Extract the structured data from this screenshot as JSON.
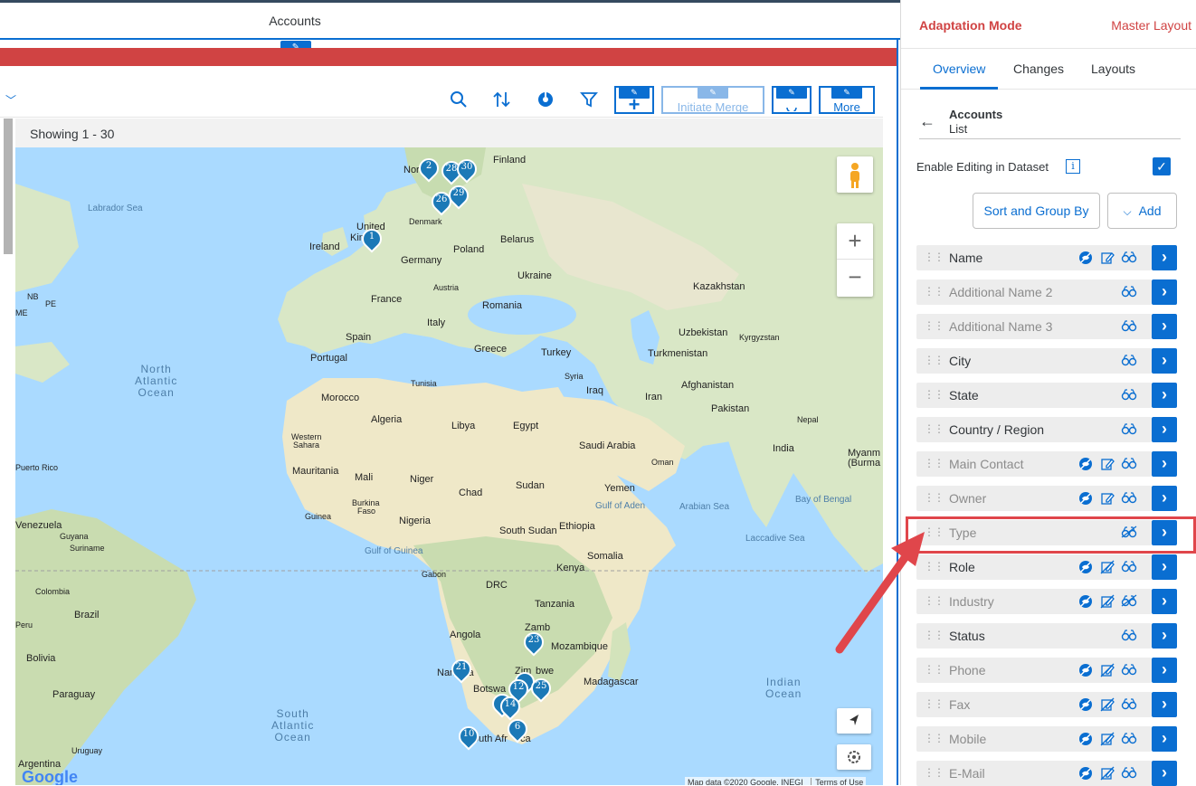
{
  "app": {
    "title": "Accounts",
    "edit_glyph": "✎",
    "toolbar": {
      "search_icon": "search-icon",
      "sort_icon": "sort-icon",
      "chart_icon": "pie-chart-icon",
      "filter_icon": "filter-icon",
      "add_glyph": "+",
      "initiate_merge": "Initiate Merge",
      "more": "More"
    },
    "showing": "Showing 1 - 30"
  },
  "map": {
    "labels": [
      {
        "t": "Finland"
      },
      {
        "t": "Nor"
      },
      {
        "t": "Labrador Sea"
      },
      {
        "t": "United"
      },
      {
        "t": "Kin"
      },
      {
        "t": "Ireland"
      },
      {
        "t": "Denmark"
      },
      {
        "t": "Belarus"
      },
      {
        "t": "Poland"
      },
      {
        "t": "Germany"
      },
      {
        "t": "Ukraine"
      },
      {
        "t": "Austria"
      },
      {
        "t": "France"
      },
      {
        "t": "Kazakhstan"
      },
      {
        "t": "Romania"
      },
      {
        "t": "Italy"
      },
      {
        "t": "Uzbekistan"
      },
      {
        "t": "Kyrgyzstan"
      },
      {
        "t": "Spain"
      },
      {
        "t": "Turkmenistan"
      },
      {
        "t": "Greece"
      },
      {
        "t": "Turkey"
      },
      {
        "t": "Portugal"
      },
      {
        "t": "Syria"
      },
      {
        "t": "Tunisia"
      },
      {
        "t": "Afghanistan"
      },
      {
        "t": "Iraq"
      },
      {
        "t": "Iran"
      },
      {
        "t": "Morocco"
      },
      {
        "t": "Pakistan"
      },
      {
        "t": "Algeria"
      },
      {
        "t": "Libya"
      },
      {
        "t": "Egypt"
      },
      {
        "t": "Nepal"
      },
      {
        "t": "Saudi Arabia"
      },
      {
        "t": "Western"
      },
      {
        "t": "Sahara"
      },
      {
        "t": "India"
      },
      {
        "t": "Oman"
      },
      {
        "t": "Mauritania"
      },
      {
        "t": "Mali"
      },
      {
        "t": "Niger"
      },
      {
        "t": "Sudan"
      },
      {
        "t": "Yemen"
      },
      {
        "t": "Chad"
      },
      {
        "t": "Gulf of Aden"
      },
      {
        "t": "Arabian Sea"
      },
      {
        "t": "Bay of Bengal"
      },
      {
        "t": "Burkina"
      },
      {
        "t": "Faso"
      },
      {
        "t": "Guinea"
      },
      {
        "t": "Nigeria"
      },
      {
        "t": "South Sudan"
      },
      {
        "t": "Ethiopia"
      },
      {
        "t": "Venezuela"
      },
      {
        "t": "Guyana"
      },
      {
        "t": "Suriname"
      },
      {
        "t": "Laccadive Sea"
      },
      {
        "t": "Gulf of Guinea"
      },
      {
        "t": "Somalia"
      },
      {
        "t": "Gabon"
      },
      {
        "t": "Kenya"
      },
      {
        "t": "DRC"
      },
      {
        "t": "Tanzania"
      },
      {
        "t": "Colombia"
      },
      {
        "t": "Brazil"
      },
      {
        "t": "Angola"
      },
      {
        "t": "Zamb"
      },
      {
        "t": "Mozambique"
      },
      {
        "t": "Bolivia"
      },
      {
        "t": "Nam"
      },
      {
        "t": "ia"
      },
      {
        "t": "Zim"
      },
      {
        "t": "bwe"
      },
      {
        "t": "Madagascar"
      },
      {
        "t": "Botswa"
      },
      {
        "t": "Paraguay"
      },
      {
        "t": "outh Afr"
      },
      {
        "t": "ca"
      },
      {
        "t": "Uruguay"
      },
      {
        "t": "Argentina"
      },
      {
        "t": "Myanm"
      },
      {
        "t": "(Burma"
      },
      {
        "t": "Puerto Rico"
      },
      {
        "t": "NB"
      },
      {
        "t": "PE"
      },
      {
        "t": "ME"
      },
      {
        "t": "Peru"
      }
    ],
    "oceans": [
      {
        "t": "North\nAtlantic\nOcean"
      },
      {
        "t": "South\nAtlantic\nOcean"
      },
      {
        "t": "Indian\nOcean"
      }
    ],
    "markers": [
      "2",
      "28",
      "30",
      "26",
      "29",
      "1",
      "23",
      "21",
      "12",
      "14",
      "25",
      "6",
      "10"
    ],
    "google": "Google",
    "attribution": "Map data ©2020 Google, INEGI",
    "terms": "Terms of Use",
    "zoom_in": "+",
    "zoom_out": "−"
  },
  "panel": {
    "title": "Adaptation Mode",
    "layout": "Master Layout",
    "tabs": [
      "Overview",
      "Changes",
      "Layouts"
    ],
    "back_glyph": "←",
    "crumb_title": "Accounts",
    "crumb_sub": "List",
    "enable_editing": "Enable Editing in Dataset",
    "info_glyph": "i",
    "check_glyph": "✓",
    "sort_group": "Sort and Group By",
    "add": "Add",
    "add_chevron": "⌵",
    "grip": "⋮⋮",
    "go_glyph": "›",
    "fields": [
      {
        "name": "Name",
        "dim": false,
        "icons": [
          "hide",
          "edit",
          "view"
        ]
      },
      {
        "name": "Additional Name 2",
        "dim": true,
        "icons": [
          "view"
        ]
      },
      {
        "name": "Additional Name 3",
        "dim": true,
        "icons": [
          "view"
        ]
      },
      {
        "name": "City",
        "dim": false,
        "icons": [
          "view"
        ]
      },
      {
        "name": "State",
        "dim": false,
        "icons": [
          "view"
        ]
      },
      {
        "name": "Country / Region",
        "dim": false,
        "icons": [
          "view"
        ]
      },
      {
        "name": "Main Contact",
        "dim": true,
        "icons": [
          "hide",
          "edit",
          "view"
        ]
      },
      {
        "name": "Owner",
        "dim": true,
        "icons": [
          "hide",
          "edit",
          "view"
        ]
      },
      {
        "name": "Type",
        "dim": true,
        "icons": [
          "view-off"
        ]
      },
      {
        "name": "Role",
        "dim": false,
        "icons": [
          "hide",
          "edit-off",
          "view"
        ]
      },
      {
        "name": "Industry",
        "dim": true,
        "icons": [
          "hide",
          "edit-off",
          "view-off"
        ]
      },
      {
        "name": "Status",
        "dim": false,
        "icons": [
          "view"
        ]
      },
      {
        "name": "Phone",
        "dim": true,
        "icons": [
          "hide",
          "edit-off",
          "view"
        ]
      },
      {
        "name": "Fax",
        "dim": true,
        "icons": [
          "hide",
          "edit-off",
          "view"
        ]
      },
      {
        "name": "Mobile",
        "dim": true,
        "icons": [
          "hide",
          "edit-off",
          "view"
        ]
      },
      {
        "name": "E-Mail",
        "dim": true,
        "icons": [
          "hide",
          "edit-off",
          "view"
        ]
      }
    ]
  },
  "colors": {
    "accent": "#0a6ed1",
    "alert": "#d04343",
    "callout": "#e0464b"
  }
}
